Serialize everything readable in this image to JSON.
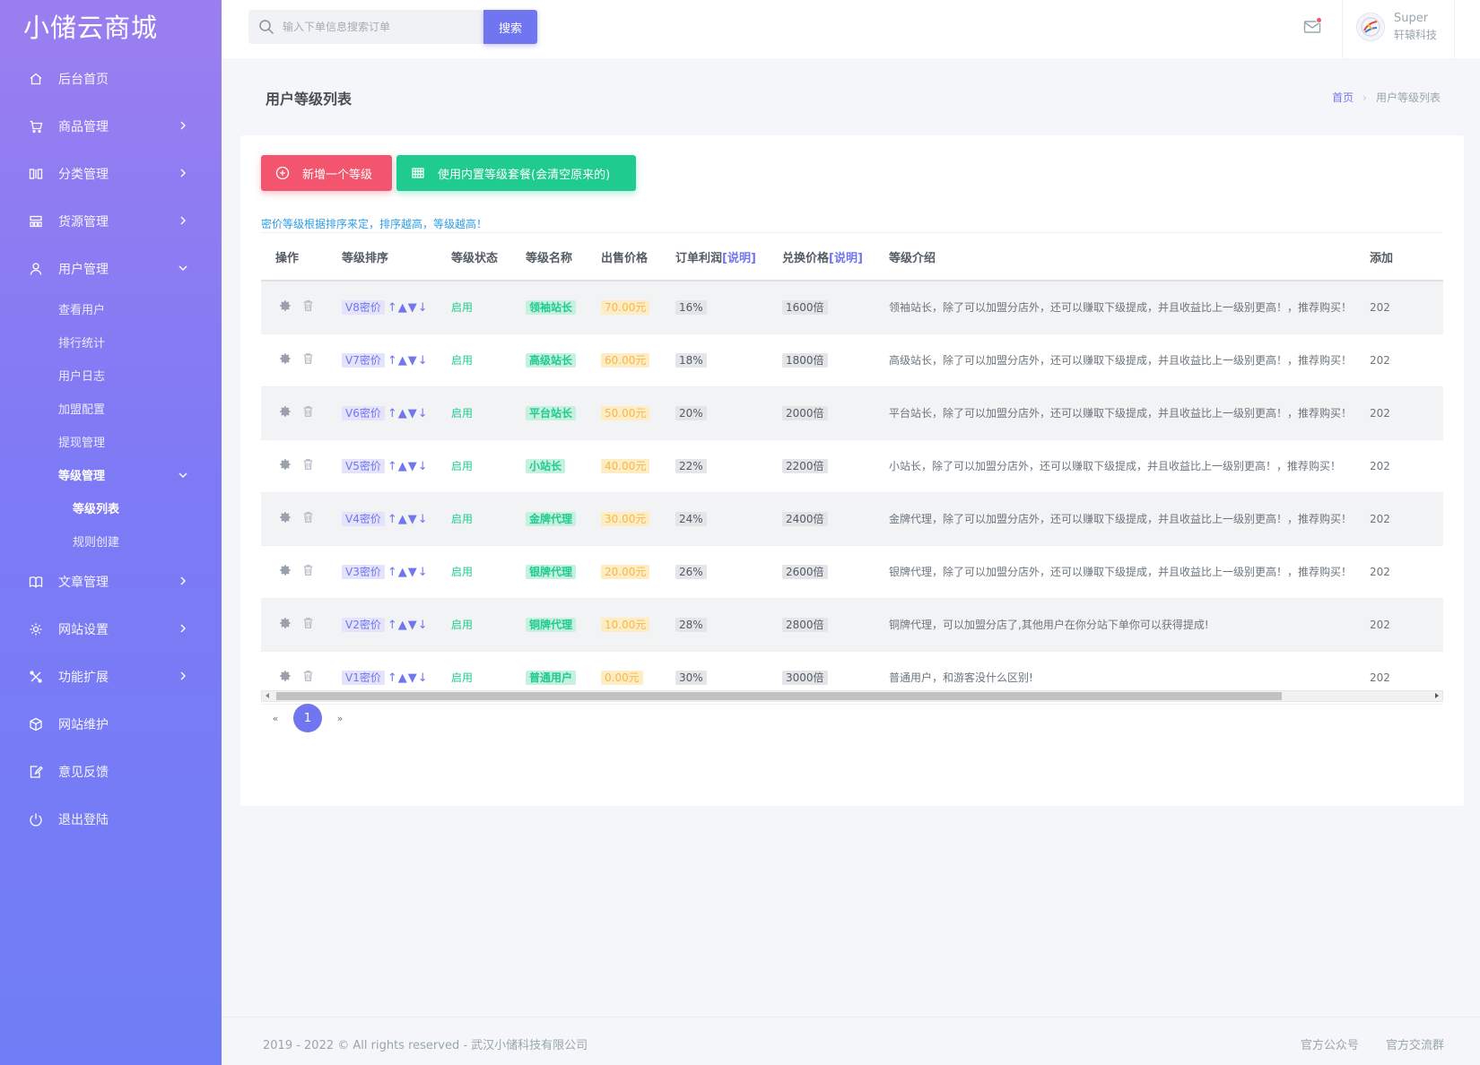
{
  "brand": "小储云商城",
  "sidebar": {
    "items": [
      {
        "label": "后台首页",
        "icon": "home-icon"
      },
      {
        "label": "商品管理",
        "icon": "cart-icon"
      },
      {
        "label": "分类管理",
        "icon": "columns-icon"
      },
      {
        "label": "货源管理",
        "icon": "grid-icon"
      },
      {
        "label": "用户管理",
        "icon": "user-icon"
      }
    ],
    "user_sub": [
      "查看用户",
      "排行统计",
      "用户日志",
      "加盟配置",
      "提现管理"
    ],
    "level_mgmt": "等级管理",
    "level_sub": [
      "等级列表",
      "规则创建"
    ],
    "items2": [
      {
        "label": "文章管理",
        "icon": "book-icon"
      },
      {
        "label": "网站设置",
        "icon": "settings-icon"
      },
      {
        "label": "功能扩展",
        "icon": "tools-icon"
      },
      {
        "label": "网站维护",
        "icon": "box-icon"
      },
      {
        "label": "意见反馈",
        "icon": "feedback-icon"
      },
      {
        "label": "退出登陆",
        "icon": "power-icon"
      }
    ]
  },
  "topbar": {
    "search_placeholder": "输入下单信息搜索订单",
    "search_button": "搜索",
    "user_name": "Super",
    "user_org": "轩辕科技"
  },
  "page": {
    "title": "用户等级列表",
    "breadcrumb_home": "首页",
    "breadcrumb_current": "用户等级列表"
  },
  "toolbar": {
    "add_label": "新增一个等级",
    "preset_label": "使用内置等级套餐(会清空原来的)",
    "hint": "密价等级根据排序来定，排序越高，等级越高！"
  },
  "table": {
    "headers": {
      "op": "操作",
      "sort": "等级排序",
      "status": "等级状态",
      "name": "等级名称",
      "price": "出售价格",
      "profit": "订单利润",
      "exchange": "兑换价格",
      "explain": "[说明]",
      "intro": "等级介绍",
      "added": "添加"
    },
    "rows": [
      {
        "level": "V8密价",
        "status": "启用",
        "name": "领袖站长",
        "price": "70.00元",
        "profit": "16%",
        "exchange": "1600倍",
        "intro": "领袖站长，除了可以加盟分店外，还可以赚取下级提成，并且收益比上一级别更高！，推荐购买！",
        "added": "202"
      },
      {
        "level": "V7密价",
        "status": "启用",
        "name": "高级站长",
        "price": "60.00元",
        "profit": "18%",
        "exchange": "1800倍",
        "intro": "高级站长，除了可以加盟分店外，还可以赚取下级提成，并且收益比上一级别更高！，推荐购买！",
        "added": "202"
      },
      {
        "level": "V6密价",
        "status": "启用",
        "name": "平台站长",
        "price": "50.00元",
        "profit": "20%",
        "exchange": "2000倍",
        "intro": "平台站长，除了可以加盟分店外，还可以赚取下级提成，并且收益比上一级别更高！，推荐购买！",
        "added": "202"
      },
      {
        "level": "V5密价",
        "status": "启用",
        "name": "小站长",
        "price": "40.00元",
        "profit": "22%",
        "exchange": "2200倍",
        "intro": "小站长，除了可以加盟分店外，还可以赚取下级提成，并且收益比上一级别更高！，推荐购买！",
        "added": "202"
      },
      {
        "level": "V4密价",
        "status": "启用",
        "name": "金牌代理",
        "price": "30.00元",
        "profit": "24%",
        "exchange": "2400倍",
        "intro": "金牌代理，除了可以加盟分店外，还可以赚取下级提成，并且收益比上一级别更高！，推荐购买！",
        "added": "202"
      },
      {
        "level": "V3密价",
        "status": "启用",
        "name": "银牌代理",
        "price": "20.00元",
        "profit": "26%",
        "exchange": "2600倍",
        "intro": "银牌代理，除了可以加盟分店外，还可以赚取下级提成，并且收益比上一级别更高！，推荐购买！",
        "added": "202"
      },
      {
        "level": "V2密价",
        "status": "启用",
        "name": "铜牌代理",
        "price": "10.00元",
        "profit": "28%",
        "exchange": "2800倍",
        "intro": "铜牌代理，可以加盟分店了,其他用户在你分站下单你可以获得提成!",
        "added": "202"
      },
      {
        "level": "V1密价",
        "status": "启用",
        "name": "普通用户",
        "price": "0.00元",
        "profit": "30%",
        "exchange": "3000倍",
        "intro": "普通用户，和游客没什么区别!",
        "added": "202"
      }
    ],
    "sort_arrows": "↑▲▼↓"
  },
  "pagination": {
    "prev": "«",
    "current": "1",
    "next": "»"
  },
  "footer": {
    "copyright": "2019 - 2022 © All rights reserved - 武汉小储科技有限公司",
    "link1": "官方公众号",
    "link2": "官方交流群"
  },
  "colors": {
    "accent": "#7076ef",
    "danger": "#f3556e",
    "success": "#1fcb8f",
    "warning": "#f7b84b"
  }
}
